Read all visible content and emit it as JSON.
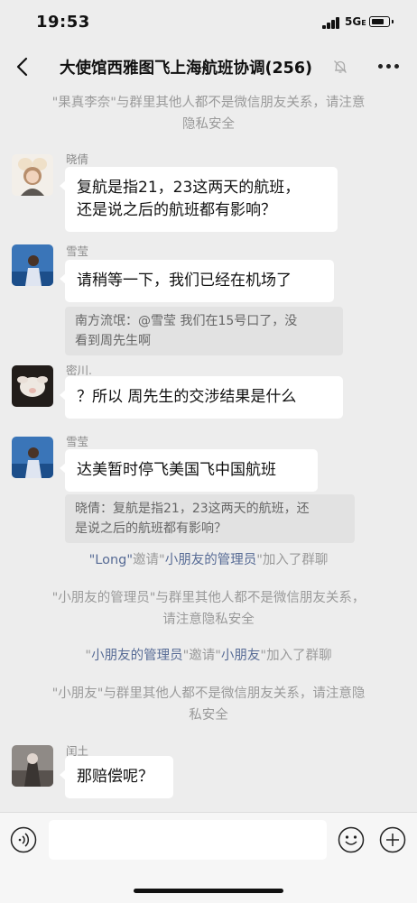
{
  "status": {
    "time": "19:53",
    "network": "5G",
    "network_suffix": "E",
    "battery_level": 0.8
  },
  "header": {
    "title": "大使馆西雅图飞上海航班协调(256)",
    "muted": true
  },
  "notices": {
    "top": {
      "parts": [
        {
          "text": "\"果真李奈\"与群里其他人都不是微信朋友关系，请注意",
          "hl": false
        },
        {
          "text": "隐私安全",
          "hl": false
        }
      ]
    },
    "invite1": {
      "parts": [
        {
          "text": "\"Long\"",
          "hl": true
        },
        {
          "text": "邀请\"",
          "hl": false
        },
        {
          "text": "小朋友的管理员",
          "hl": true
        },
        {
          "text": "\"加入了群聊",
          "hl": false
        }
      ]
    },
    "warn1": {
      "line1": "\"小朋友的管理员\"与群里其他人都不是微信朋友关系，",
      "line2": "请注意隐私安全"
    },
    "invite2": {
      "parts": [
        {
          "text": "\"",
          "hl": false
        },
        {
          "text": "小朋友的管理员",
          "hl": true
        },
        {
          "text": "\"邀请\"",
          "hl": false
        },
        {
          "text": "小朋友",
          "hl": true
        },
        {
          "text": "\"加入了群聊",
          "hl": false
        }
      ]
    },
    "warn2": {
      "line1": "\"小朋友\"与群里其他人都不是微信朋友关系，请注意隐",
      "line2": "私安全"
    }
  },
  "messages": [
    {
      "sender": "晓倩",
      "lines": [
        "复航是指21，23这两天的航班，",
        "还是说之后的航班都有影响？"
      ]
    },
    {
      "sender": "雪莹",
      "lines": [
        "请稍等一下，我们已经在机场了"
      ],
      "quote": [
        "南方流氓：@雪莹 我们在15号口了，没",
        "看到周先生啊"
      ]
    },
    {
      "sender": "密川.",
      "lines": [
        "？所以 周先生的交涉结果是什么"
      ]
    },
    {
      "sender": "雪莹",
      "lines": [
        "达美暂时停飞美国飞中国航班"
      ],
      "quote": [
        "晓倩：复航是指21，23这两天的航班，还",
        "是说之后的航班都有影响？"
      ]
    },
    {
      "sender": "闰土",
      "lines": [
        "那赔偿呢？"
      ]
    }
  ],
  "input": {
    "value": "",
    "placeholder": ""
  },
  "icons": {
    "back": "chevron-left-icon",
    "mute": "bell-off-icon",
    "more": "more-dots-icon",
    "voice": "voice-icon",
    "emoji": "emoji-icon",
    "plus": "plus-icon"
  }
}
